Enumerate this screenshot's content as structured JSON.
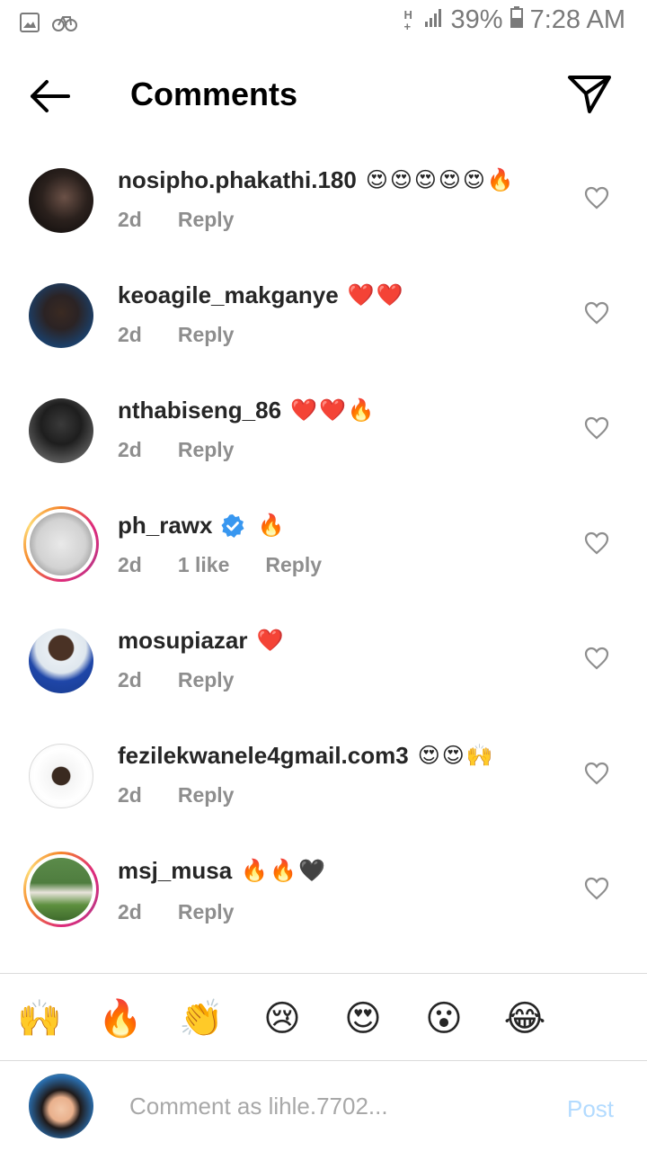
{
  "status_bar": {
    "network": "H+",
    "battery": "39%",
    "time": "7:28 AM"
  },
  "header": {
    "title": "Comments"
  },
  "comments": [
    {
      "username": "nosipho.phakathi.180",
      "emojis": "😍😍😍😍😍🔥",
      "age": "2d",
      "likes": "",
      "reply": "Reply",
      "verified": false,
      "story_ring": false
    },
    {
      "username": "keoagile_makganye",
      "emojis": "❤️❤️",
      "age": "2d",
      "likes": "",
      "reply": "Reply",
      "verified": false,
      "story_ring": false
    },
    {
      "username": "nthabiseng_86",
      "emojis": "❤️❤️🔥",
      "age": "2d",
      "likes": "",
      "reply": "Reply",
      "verified": false,
      "story_ring": false
    },
    {
      "username": "ph_rawx",
      "emojis": "🔥",
      "age": "2d",
      "likes": "1 like",
      "reply": "Reply",
      "verified": true,
      "story_ring": true
    },
    {
      "username": "mosupiazar",
      "emojis": "❤️",
      "age": "2d",
      "likes": "",
      "reply": "Reply",
      "verified": false,
      "story_ring": false
    },
    {
      "username": "fezilekwanele4gmail.com3",
      "emojis": "😍😍🙌",
      "age": "2d",
      "likes": "",
      "reply": "Reply",
      "verified": false,
      "story_ring": false
    },
    {
      "username": "msj_musa",
      "emojis": "🔥🔥🖤",
      "age": "2d",
      "likes": "",
      "reply": "Reply",
      "verified": false,
      "story_ring": true
    }
  ],
  "quick_reactions": [
    "🙌",
    "🔥",
    "👏",
    "😢",
    "😍",
    "😮",
    "😂"
  ],
  "composer": {
    "placeholder": "Comment as lihle.7702...",
    "post_label": "Post"
  },
  "colors": {
    "accent_disabled": "#b3dbff",
    "secondary_text": "#8e8e8e",
    "verified_blue": "#3897f0"
  }
}
